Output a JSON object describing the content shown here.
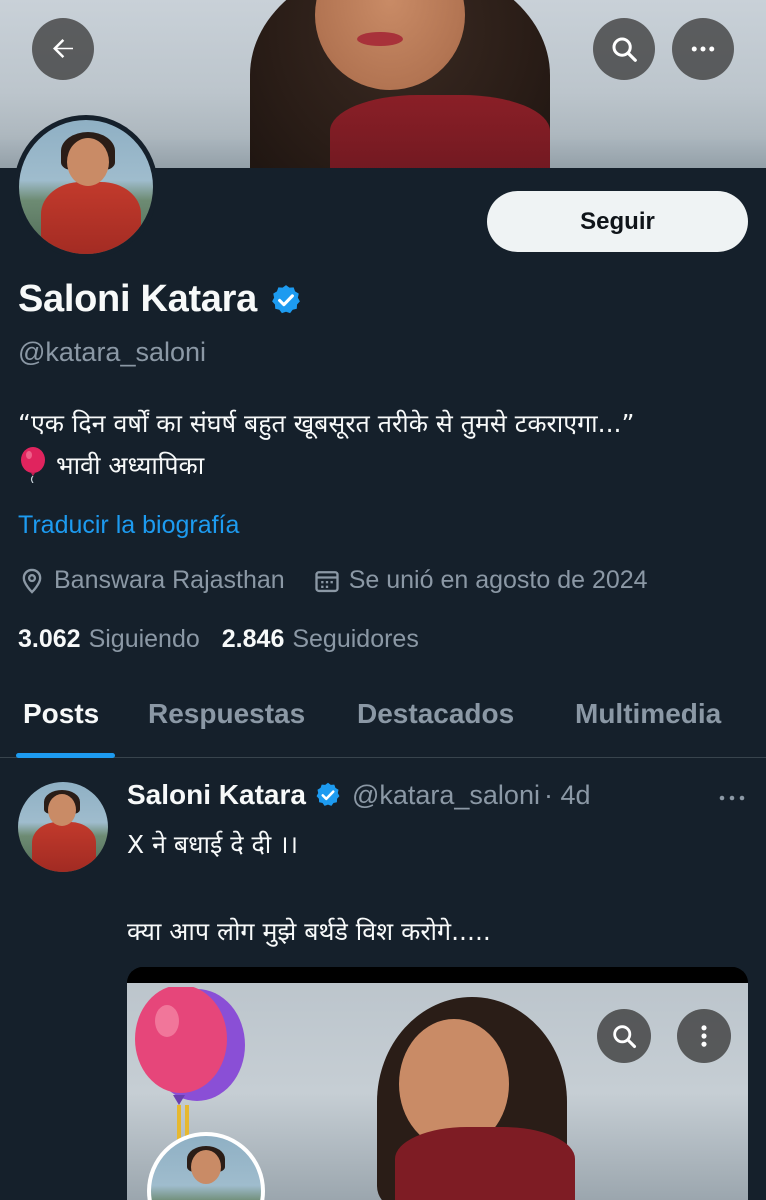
{
  "profile": {
    "name": "Saloni Katara",
    "handle": "@katara_saloni",
    "follow_label": "Seguir",
    "bio_line1": "“एक दिन वर्षों का संघर्ष बहुत खूबसूरत तरीके से तुमसे टकराएगा...”",
    "bio_line2": "भावी अध्यापिका",
    "translate_label": "Traducir la biografía",
    "location": "Banswara Rajasthan",
    "joined": "Se unió en agosto de 2024",
    "following_count": "3.062",
    "following_label": "Siguiendo",
    "followers_count": "2.846",
    "followers_label": "Seguidores",
    "verified": true
  },
  "tabs": [
    {
      "label": "Posts",
      "active": true
    },
    {
      "label": "Respuestas",
      "active": false
    },
    {
      "label": "Destacados",
      "active": false
    },
    {
      "label": "Multimedia",
      "active": false
    }
  ],
  "post": {
    "author_name": "Saloni Katara",
    "author_handle": "@katara_saloni",
    "time": "· 4d",
    "text_line1": "X ने बधाई दे दी ।।",
    "text_line2": "क्या आप लोग मुझे बर्थडे विश करोगे....."
  },
  "colors": {
    "background": "#15202b",
    "accent": "#1d9bf0",
    "muted": "#8b98a5",
    "text": "#f7f9f9"
  },
  "icons": [
    "back-arrow-icon",
    "search-icon",
    "more-icon",
    "verified-badge-icon",
    "balloon-icon",
    "location-icon",
    "calendar-icon"
  ]
}
